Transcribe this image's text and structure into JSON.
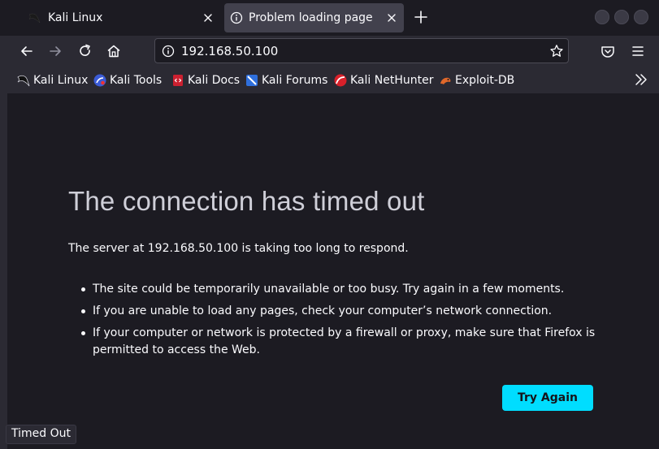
{
  "tabs": [
    {
      "title": "Kali Linux",
      "icon": "kali-dragon-icon"
    },
    {
      "title": "Problem loading page",
      "icon": "info-icon"
    }
  ],
  "navigation": {
    "url": "192.168.50.100",
    "icons": [
      "back-icon",
      "forward-icon",
      "reload-icon",
      "home-icon",
      "info-icon",
      "bookmark-star-icon",
      "pocket-icon",
      "menu-icon"
    ]
  },
  "bookmarks": [
    {
      "label": "Kali Linux",
      "icon": "kali-dragon-icon",
      "color": "#111111"
    },
    {
      "label": "Kali Tools",
      "icon": "kali-tools-icon",
      "color": "#3b5bd6"
    },
    {
      "label": "Kali Docs",
      "icon": "kali-docs-icon",
      "color": "#cc2030"
    },
    {
      "label": "Kali Forums",
      "icon": "kali-forums-icon",
      "color": "#2f6fdc"
    },
    {
      "label": "Kali NetHunter",
      "icon": "kali-nethunter-icon",
      "color": "#d8202a"
    },
    {
      "label": "Exploit-DB",
      "icon": "exploit-db-icon",
      "color": "#e0682a"
    }
  ],
  "error": {
    "title": "The connection has timed out",
    "description": "The server at 192.168.50.100 is taking too long to respond.",
    "reasons": [
      "The site could be temporarily unavailable or too busy. Try again in a few moments.",
      "If you are unable to load any pages, check your computer’s network connection.",
      "If your computer or network is protected by a firewall or proxy, make sure that Firefox is permitted to access the Web."
    ],
    "button": "Try Again"
  },
  "status": "Timed Out",
  "colors": {
    "accent": "#00ddff",
    "tabbar": "#1c1b22",
    "toolbar": "#2b2a33",
    "page_bg": "#1c1b22"
  }
}
